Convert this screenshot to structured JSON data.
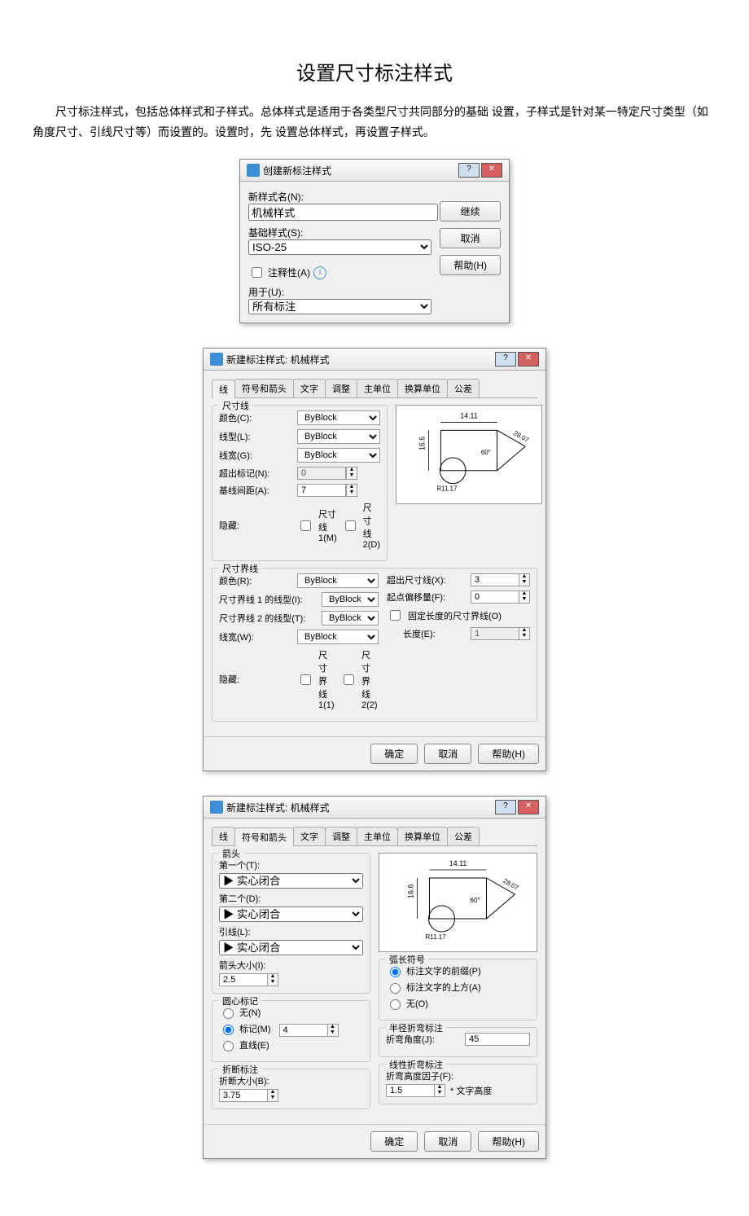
{
  "page": {
    "title": "设置尺寸标注样式",
    "intro": "尺寸标注样式，包括总体样式和子样式。总体样式是适用于各类型尺寸共同部分的基础 设置，子样式是针对某一特定尺寸类型（如角度尺寸、引线尺寸等）而设置的。设置时，先 设置总体样式，再设置子样式。"
  },
  "dialog1": {
    "title": "创建新标注样式",
    "labels": {
      "newName": "新样式名(N):",
      "newNameValue": "机械样式",
      "baseStyle": "基础样式(S):",
      "baseStyleValue": "ISO-25",
      "annotative": "注释性(A)",
      "usedFor": "用于(U):",
      "usedForValue": "所有标注"
    },
    "buttons": {
      "continue": "继续",
      "cancel": "取消",
      "help": "帮助(H)"
    }
  },
  "tabs": [
    "线",
    "符号和箭头",
    "文字",
    "调整",
    "主单位",
    "换算单位",
    "公差"
  ],
  "dialog2": {
    "title": "新建标注样式: 机械样式",
    "activeTab": 0,
    "dimLines": {
      "legend": "尺寸线",
      "color": "颜色(C):",
      "colorValue": "ByBlock",
      "linetype": "线型(L):",
      "linetypeValue": "ByBlock",
      "lineweight": "线宽(G):",
      "lineweightValue": "ByBlock",
      "extend": "超出标记(N):",
      "extendValue": "0",
      "spacing": "基线间距(A):",
      "spacingValue": "7",
      "hide": "隐藏:",
      "hide1": "尺寸线 1(M)",
      "hide2": "尺寸线 2(D)"
    },
    "extLines": {
      "legend": "尺寸界线",
      "color": "颜色(R):",
      "colorValue": "ByBlock",
      "lt1": "尺寸界线 1 的线型(I):",
      "lt1Value": "ByBlock",
      "lt2": "尺寸界线 2 的线型(T):",
      "lt2Value": "ByBlock",
      "lw": "线宽(W):",
      "lwValue": "ByBlock",
      "hide": "隐藏:",
      "hide1": "尺寸界线 1(1)",
      "hide2": "尺寸界线 2(2)",
      "extBeyond": "超出尺寸线(X):",
      "extBeyondValue": "3",
      "offset": "起点偏移量(F):",
      "offsetValue": "0",
      "fixed": "固定长度的尺寸界线(O)",
      "length": "长度(E):",
      "lengthValue": "1"
    },
    "footer": {
      "ok": "确定",
      "cancel": "取消",
      "help": "帮助(H)"
    },
    "preview": {
      "top": "14.11",
      "left": "16.6",
      "angle": "60°",
      "radius": "R11.17",
      "diag": "28.07"
    }
  },
  "dialog3": {
    "title": "新建标注样式: 机械样式",
    "activeTab": 1,
    "arrows": {
      "legend": "箭头",
      "first": "第一个(T):",
      "firstValue": "实心闭合",
      "second": "第二个(D):",
      "secondValue": "实心闭合",
      "leader": "引线(L):",
      "leaderValue": "实心闭合",
      "size": "箭头大小(I):",
      "sizeValue": "2.5"
    },
    "centerMarks": {
      "legend": "圆心标记",
      "none": "无(N)",
      "mark": "标记(M)",
      "line": "直线(E)",
      "value": "4"
    },
    "breakDim": {
      "legend": "折断标注",
      "size": "折断大小(B):",
      "value": "3.75"
    },
    "arcSymbol": {
      "legend": "弧长符号",
      "before": "标注文字的前缀(P)",
      "above": "标注文字的上方(A)",
      "none": "无(O)"
    },
    "radiusJog": {
      "legend": "半径折弯标注",
      "angle": "折弯角度(J):",
      "value": "45"
    },
    "linearJog": {
      "legend": "线性折弯标注",
      "factor": "折弯高度因子(F):",
      "value": "1.5",
      "suffix": "* 文字高度"
    },
    "footer": {
      "ok": "确定",
      "cancel": "取消",
      "help": "帮助(H)"
    },
    "preview": {
      "top": "14.11",
      "left": "16.6",
      "angle": "60°",
      "radius": "R11.17",
      "diag": "28.07"
    }
  }
}
